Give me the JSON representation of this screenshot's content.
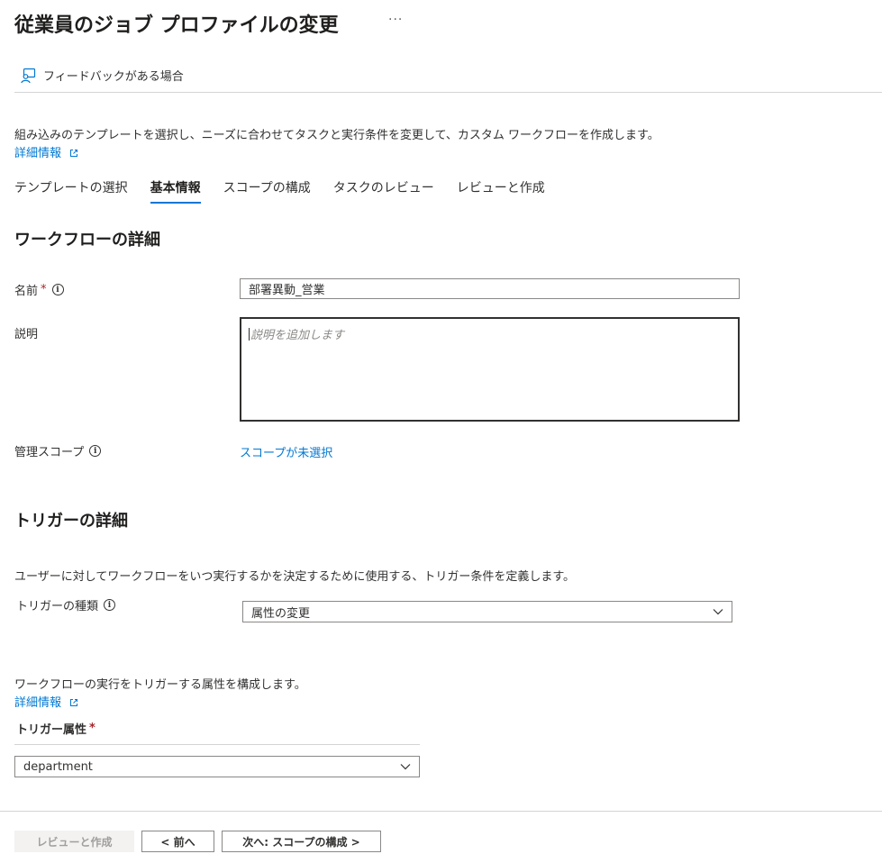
{
  "header": {
    "title": "従業員のジョブ プロファイルの変更",
    "more_label": "···"
  },
  "toolbar": {
    "feedback_label": "フィードバックがある場合"
  },
  "intro": {
    "description": "組み込みのテンプレートを選択し、ニーズに合わせてタスクと実行条件を変更して、カスタム ワークフローを作成します。",
    "learn_more": "詳細情報"
  },
  "tabs": [
    {
      "label": "テンプレートの選択"
    },
    {
      "label": "基本情報"
    },
    {
      "label": "スコープの構成"
    },
    {
      "label": "タスクのレビュー"
    },
    {
      "label": "レビューと作成"
    }
  ],
  "workflow": {
    "heading": "ワークフローの詳細",
    "name_label": "名前",
    "required_mark": "*",
    "name_value": "部署異動_営業",
    "description_label": "説明",
    "description_placeholder": "説明を追加します",
    "scope_label": "管理スコープ",
    "scope_link": "スコープが未選択"
  },
  "trigger": {
    "heading": "トリガーの詳細",
    "description": "ユーザーに対してワークフローをいつ実行するかを決定するために使用する、トリガー条件を定義します。",
    "type_label": "トリガーの種類",
    "type_value": "属性の変更",
    "attr_description": "ワークフローの実行をトリガーする属性を構成します。",
    "learn_more": "詳細情報",
    "attr_label": "トリガー属性",
    "required_mark": "*",
    "attr_value": "department"
  },
  "footer": {
    "review_create": "レビューと作成",
    "prev": "< 前へ",
    "next": "次へ: スコープの構成 >"
  },
  "colors": {
    "accent": "#0078d4",
    "required": "#a4262c",
    "text": "#323130"
  }
}
